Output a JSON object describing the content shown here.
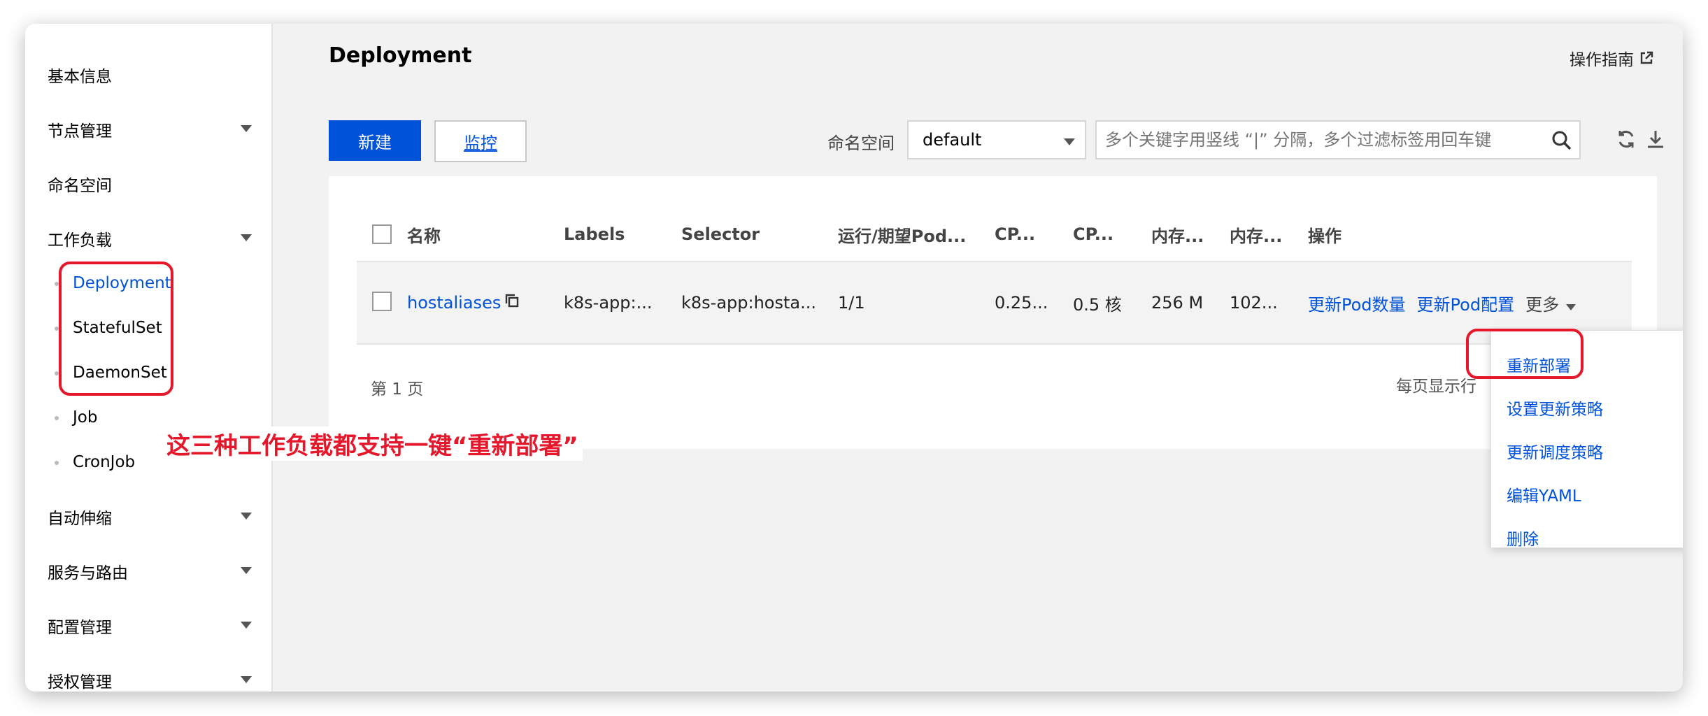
{
  "sidebar": {
    "items": [
      {
        "label": "基本信息",
        "has_children": false
      },
      {
        "label": "节点管理",
        "has_children": true
      },
      {
        "label": "命名空间",
        "has_children": false
      },
      {
        "label": "工作负载",
        "has_children": true
      },
      {
        "label": "自动伸缩",
        "has_children": true
      },
      {
        "label": "服务与路由",
        "has_children": true
      },
      {
        "label": "配置管理",
        "has_children": true
      },
      {
        "label": "授权管理",
        "has_children": true
      }
    ],
    "workload_subitems": [
      {
        "label": "Deployment",
        "active": true
      },
      {
        "label": "StatefulSet",
        "active": false
      },
      {
        "label": "DaemonSet",
        "active": false
      },
      {
        "label": "Job",
        "active": false
      },
      {
        "label": "CronJob",
        "active": false
      }
    ]
  },
  "header": {
    "title": "Deployment",
    "guide_label": "操作指南"
  },
  "toolbar": {
    "create_label": "新建",
    "monitor_label": "监控",
    "namespace_label": "命名空间",
    "namespace_value": "default",
    "search_placeholder": "多个关键字用竖线 “|” 分隔，多个过滤标签用回车键"
  },
  "table": {
    "columns": [
      "名称",
      "Labels",
      "Selector",
      "运行/期望Pod...",
      "CP...",
      "CP...",
      "内存...",
      "内存...",
      "操作"
    ],
    "rows": [
      {
        "name": "hostaliases",
        "labels": "k8s-app:...",
        "selector": "k8s-app:hosta...",
        "pods": "1/1",
        "cpu_request": "0.25...",
        "cpu_limit": "0.5 核",
        "mem_request": "256 M",
        "mem_limit": "102...",
        "actions": [
          "更新Pod数量",
          "更新Pod配置",
          "更多"
        ]
      }
    ],
    "page_label": "第 1 页",
    "per_page_label": "每页显示行"
  },
  "dropdown": {
    "items": [
      "重新部署",
      "设置更新策略",
      "更新调度策略",
      "编辑YAML",
      "删除"
    ]
  },
  "annotation": {
    "text": "这三种工作负载都支持一键“重新部署”",
    "color": "#e5172b"
  },
  "colors": {
    "accent": "#0052d9"
  }
}
